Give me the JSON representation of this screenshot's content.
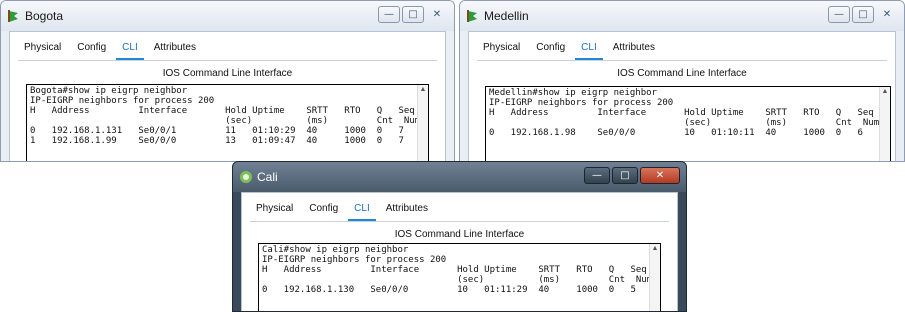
{
  "bogota": {
    "title": "Bogota",
    "tabs": [
      "Physical",
      "Config",
      "CLI",
      "Attributes"
    ],
    "active_tab": "CLI",
    "panel_title": "IOS Command Line Interface",
    "terminal": "Bogota#show ip eigrp neighbor\nIP-EIGRP neighbors for process 200\nH   Address         Interface       Hold Uptime    SRTT   RTO   Q   Seq\n                                    (sec)          (ms)         Cnt  Num\n0   192.168.1.131   Se0/0/1         11   01:10:29  40     1000  0   7\n1   192.168.1.99    Se0/0/0         13   01:09:47  40     1000  0   7"
  },
  "medellin": {
    "title": "Medellin",
    "tabs": [
      "Physical",
      "Config",
      "CLI",
      "Attributes"
    ],
    "active_tab": "CLI",
    "panel_title": "IOS Command Line Interface",
    "terminal": "Medellin#show ip eigrp neighbor\nIP-EIGRP neighbors for process 200\nH   Address         Interface       Hold Uptime    SRTT   RTO   Q   Seq\n                                    (sec)          (ms)         Cnt  Num\n0   192.168.1.98    Se0/0/0         10   01:10:11  40     1000  0   6"
  },
  "cali": {
    "title": "Cali",
    "tabs": [
      "Physical",
      "Config",
      "CLI",
      "Attributes"
    ],
    "active_tab": "CLI",
    "panel_title": "IOS Command Line Interface",
    "terminal": "Cali#show ip eigrp neighbor\nIP-EIGRP neighbors for process 200\nH   Address         Interface       Hold Uptime    SRTT   RTO   Q   Seq\n                                    (sec)          (ms)         Cnt  Num\n0   192.168.1.130   Se0/0/0         10   01:11:29  40     1000  0   5"
  },
  "icons": {
    "app": "packet-tracer-router-icon",
    "minimize": "minimize-icon",
    "maximize": "maximize-icon",
    "close": "close-icon"
  },
  "colors": {
    "accent": "#1e8ad6",
    "dark_title": "#4a5b6c",
    "close_red": "#c0472f"
  }
}
